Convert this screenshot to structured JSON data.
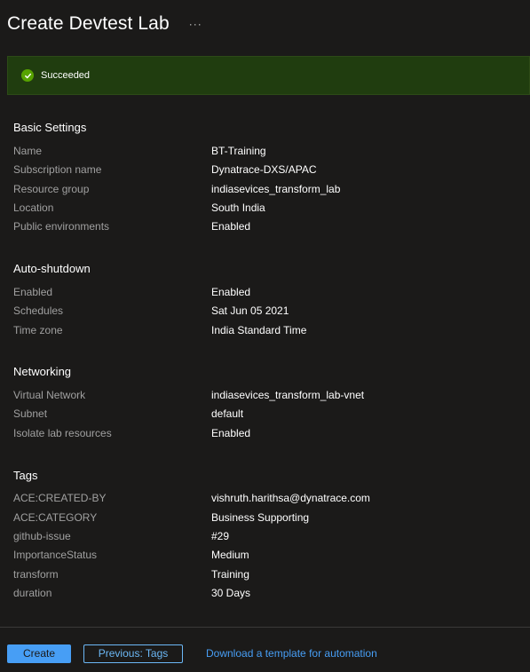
{
  "page": {
    "title": "Create Devtest Lab",
    "more": "···"
  },
  "banner": {
    "status": "Succeeded",
    "icon": "checkmark-circle-icon",
    "color": "#57a300"
  },
  "sections": {
    "basic": {
      "title": "Basic Settings",
      "rows": [
        {
          "label": "Name",
          "value": "BT-Training"
        },
        {
          "label": "Subscription name",
          "value": "Dynatrace-DXS/APAC"
        },
        {
          "label": "Resource group",
          "value": "indiasevices_transform_lab"
        },
        {
          "label": "Location",
          "value": "South India"
        },
        {
          "label": "Public environments",
          "value": "Enabled"
        }
      ]
    },
    "autoshutdown": {
      "title": "Auto-shutdown",
      "rows": [
        {
          "label": "Enabled",
          "value": "Enabled"
        },
        {
          "label": "Schedules",
          "value": "Sat Jun 05 2021"
        },
        {
          "label": "Time zone",
          "value": "India Standard Time"
        }
      ]
    },
    "networking": {
      "title": "Networking",
      "rows": [
        {
          "label": "Virtual Network",
          "value": "indiasevices_transform_lab-vnet"
        },
        {
          "label": "Subnet",
          "value": "default"
        },
        {
          "label": "Isolate lab resources",
          "value": "Enabled"
        }
      ]
    },
    "tags": {
      "title": "Tags",
      "rows": [
        {
          "label": "ACE:CREATED-BY",
          "value": "vishruth.harithsa@dynatrace.com"
        },
        {
          "label": "ACE:CATEGORY",
          "value": "Business Supporting"
        },
        {
          "label": "github-issue",
          "value": "#29"
        },
        {
          "label": "ImportanceStatus",
          "value": "Medium"
        },
        {
          "label": "transform",
          "value": "Training"
        },
        {
          "label": "duration",
          "value": "30 Days"
        }
      ]
    }
  },
  "footer": {
    "create_label": "Create",
    "previous_label": "Previous: Tags",
    "download_label": "Download a template for automation"
  },
  "colors": {
    "background": "#1b1a19",
    "accent": "#479ef5",
    "success_banner": "#203d0f"
  }
}
